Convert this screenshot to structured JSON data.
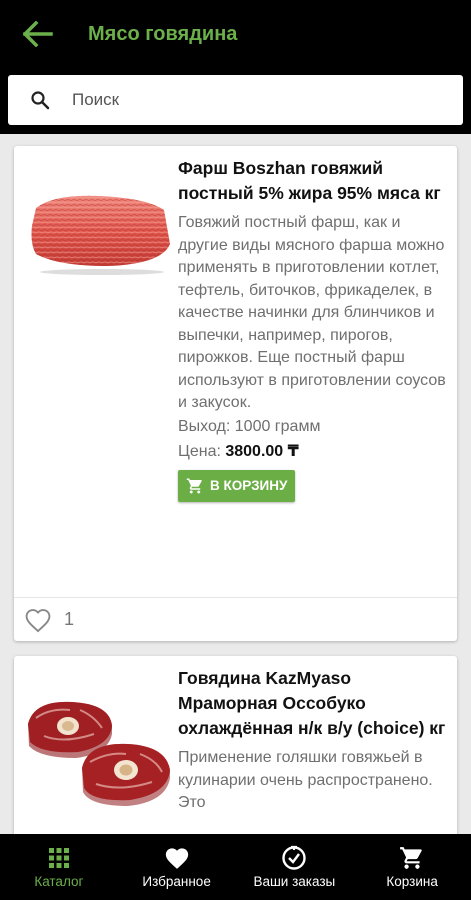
{
  "header": {
    "title": "Мясо говядина",
    "back_icon": "arrow-back-icon",
    "accent_color": "#6bb04a"
  },
  "search": {
    "placeholder": "Поиск",
    "value": ""
  },
  "products": [
    {
      "name": "Фарш Boszhan говяжий постный 5% жира 95% мяса кг",
      "description": "Говяжий постный фарш, как и другие виды мясного фарша можно применять в приготовлении котлет, тефтель, биточков, фрикаделек, в качестве начинки для блинчиков и выпечки, например, пирогов, пирожков. Еще постный фарш используют в приготовлении соусов и закусок.",
      "yield": "Выход: 1000 грамм",
      "price_label": "Цена: ",
      "price_value": "3800.00 ₸",
      "cart_label": "В КОРЗИНУ",
      "likes": "1",
      "image_icon": "ground-beef-image"
    },
    {
      "name": "Говядина KazMyaso Мраморная Оссобуко охлаждённая н/к в/у (choice) кг",
      "description": "Применение голяшки говяжьей в кулинарии очень распространено. Это",
      "image_icon": "ossobuco-beef-image"
    }
  ],
  "nav": [
    {
      "label": "Каталог",
      "icon": "grid-icon",
      "active": true
    },
    {
      "label": "Избранное",
      "icon": "heart-icon",
      "active": false
    },
    {
      "label": "Ваши заказы",
      "icon": "orders-icon",
      "active": false
    },
    {
      "label": "Корзина",
      "icon": "cart-icon",
      "active": false
    }
  ],
  "colors": {
    "primary": "#6bae45",
    "background": "#eaeaea",
    "text_secondary": "#6f6f6f"
  }
}
